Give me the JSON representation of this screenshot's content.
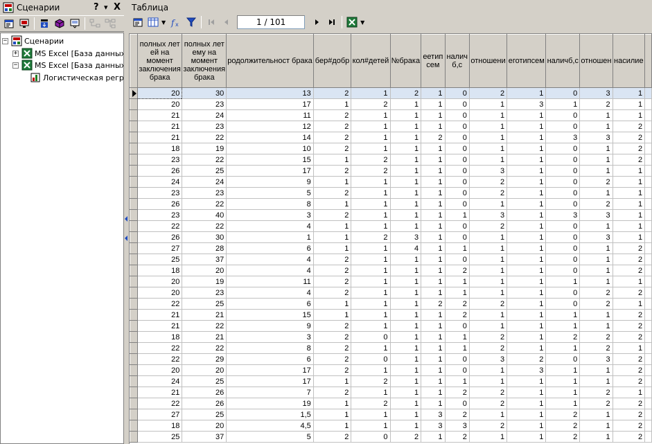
{
  "left_panel": {
    "title": "Сценарии",
    "controls": {
      "help": "?",
      "dropdown": "▾",
      "close": "X"
    },
    "tree": {
      "root": "Сценарии",
      "items": [
        {
          "label": "MS Excel [База данных: C",
          "expander": "+"
        },
        {
          "label": "MS Excel [База данных: C",
          "expander": "−"
        },
        {
          "label": "Логистическая регрес",
          "expander": ""
        }
      ]
    }
  },
  "right_panel": {
    "title": "Таблица",
    "navigation": {
      "position": "1 / 101"
    }
  },
  "colors": {
    "current_row": "#dae5f3",
    "chrome": "#d4d0c8",
    "excel_green": "#1f7a3a"
  },
  "table": {
    "columns": [
      "полных лет ей на момент заключения брака",
      "полных лет ему на момент заключения брака",
      "родолжительност брака",
      "бер#добр",
      "кол#детей",
      "№брака",
      "еетип сем",
      "налич б,с",
      "отношени",
      "еготипсем",
      "наличб,с",
      "отношен",
      "насилие"
    ],
    "rows": [
      [
        "20",
        "30",
        "13",
        "2",
        "1",
        "2",
        "1",
        "0",
        "2",
        "1",
        "0",
        "3",
        "1"
      ],
      [
        "20",
        "23",
        "17",
        "1",
        "2",
        "1",
        "1",
        "0",
        "1",
        "3",
        "1",
        "2",
        "1"
      ],
      [
        "21",
        "24",
        "11",
        "2",
        "1",
        "1",
        "1",
        "0",
        "1",
        "1",
        "0",
        "1",
        "1"
      ],
      [
        "21",
        "23",
        "12",
        "2",
        "1",
        "1",
        "1",
        "0",
        "1",
        "1",
        "0",
        "1",
        "2"
      ],
      [
        "21",
        "22",
        "14",
        "2",
        "1",
        "1",
        "2",
        "0",
        "1",
        "1",
        "3",
        "3",
        "2"
      ],
      [
        "18",
        "19",
        "10",
        "2",
        "1",
        "1",
        "1",
        "0",
        "1",
        "1",
        "0",
        "1",
        "2"
      ],
      [
        "23",
        "22",
        "15",
        "1",
        "2",
        "1",
        "1",
        "0",
        "1",
        "1",
        "0",
        "1",
        "2"
      ],
      [
        "26",
        "25",
        "17",
        "2",
        "2",
        "1",
        "1",
        "0",
        "3",
        "1",
        "0",
        "1",
        "1"
      ],
      [
        "24",
        "24",
        "9",
        "1",
        "1",
        "1",
        "1",
        "0",
        "2",
        "1",
        "0",
        "2",
        "1"
      ],
      [
        "23",
        "23",
        "5",
        "2",
        "1",
        "1",
        "1",
        "0",
        "2",
        "1",
        "0",
        "1",
        "1"
      ],
      [
        "26",
        "22",
        "8",
        "1",
        "1",
        "1",
        "1",
        "0",
        "1",
        "1",
        "0",
        "2",
        "1"
      ],
      [
        "23",
        "40",
        "3",
        "2",
        "1",
        "1",
        "1",
        "1",
        "3",
        "1",
        "3",
        "3",
        "1"
      ],
      [
        "22",
        "22",
        "4",
        "1",
        "1",
        "1",
        "1",
        "0",
        "2",
        "1",
        "0",
        "1",
        "1"
      ],
      [
        "26",
        "30",
        "1",
        "1",
        "2",
        "3",
        "1",
        "0",
        "1",
        "1",
        "0",
        "3",
        "1"
      ],
      [
        "27",
        "28",
        "6",
        "1",
        "1",
        "4",
        "1",
        "1",
        "1",
        "1",
        "0",
        "1",
        "2"
      ],
      [
        "25",
        "37",
        "4",
        "2",
        "1",
        "1",
        "1",
        "0",
        "1",
        "1",
        "0",
        "1",
        "2"
      ],
      [
        "18",
        "20",
        "4",
        "2",
        "1",
        "1",
        "1",
        "2",
        "1",
        "1",
        "0",
        "1",
        "2"
      ],
      [
        "20",
        "19",
        "11",
        "2",
        "1",
        "1",
        "1",
        "1",
        "1",
        "1",
        "1",
        "1",
        "1"
      ],
      [
        "20",
        "23",
        "4",
        "2",
        "1",
        "1",
        "1",
        "1",
        "1",
        "1",
        "0",
        "2",
        "2"
      ],
      [
        "22",
        "25",
        "6",
        "1",
        "1",
        "1",
        "2",
        "2",
        "2",
        "1",
        "0",
        "2",
        "1"
      ],
      [
        "21",
        "21",
        "15",
        "1",
        "1",
        "1",
        "1",
        "2",
        "1",
        "1",
        "1",
        "1",
        "2"
      ],
      [
        "21",
        "22",
        "9",
        "2",
        "1",
        "1",
        "1",
        "0",
        "1",
        "1",
        "1",
        "1",
        "2"
      ],
      [
        "18",
        "21",
        "3",
        "2",
        "0",
        "1",
        "1",
        "1",
        "2",
        "1",
        "2",
        "2",
        "2"
      ],
      [
        "22",
        "22",
        "8",
        "2",
        "1",
        "1",
        "1",
        "1",
        "2",
        "1",
        "1",
        "2",
        "1"
      ],
      [
        "22",
        "29",
        "6",
        "2",
        "0",
        "1",
        "1",
        "0",
        "3",
        "2",
        "0",
        "3",
        "2"
      ],
      [
        "20",
        "20",
        "17",
        "2",
        "1",
        "1",
        "1",
        "0",
        "1",
        "3",
        "1",
        "1",
        "2"
      ],
      [
        "24",
        "25",
        "17",
        "1",
        "2",
        "1",
        "1",
        "1",
        "1",
        "1",
        "1",
        "1",
        "2"
      ],
      [
        "21",
        "26",
        "7",
        "2",
        "1",
        "1",
        "1",
        "2",
        "2",
        "1",
        "1",
        "2",
        "1"
      ],
      [
        "22",
        "26",
        "19",
        "1",
        "2",
        "1",
        "1",
        "0",
        "2",
        "1",
        "1",
        "2",
        "2"
      ],
      [
        "27",
        "25",
        "1,5",
        "1",
        "1",
        "1",
        "3",
        "2",
        "1",
        "1",
        "2",
        "1",
        "2"
      ],
      [
        "18",
        "20",
        "4,5",
        "1",
        "1",
        "1",
        "3",
        "3",
        "2",
        "1",
        "2",
        "1",
        "2"
      ],
      [
        "25",
        "37",
        "5",
        "2",
        "0",
        "2",
        "1",
        "2",
        "1",
        "1",
        "2",
        "1",
        "2"
      ]
    ]
  }
}
